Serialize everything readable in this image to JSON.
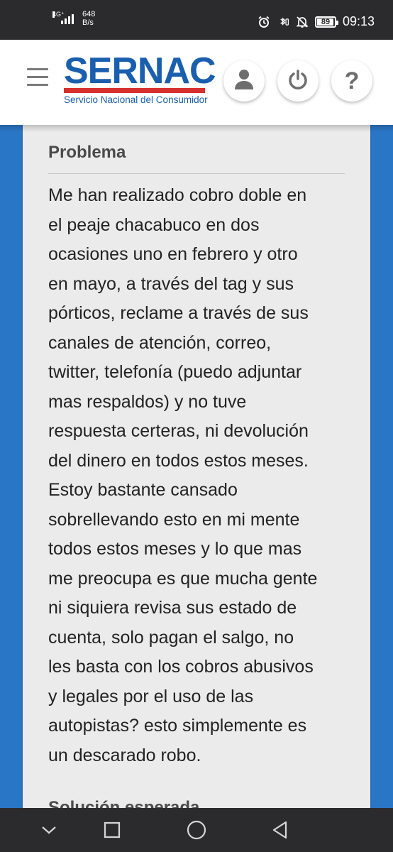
{
  "status_bar": {
    "network_type": "4G⁺",
    "speed_value": "648",
    "speed_unit": "B/s",
    "battery": "89",
    "battery_level": 0.89,
    "time": "09:13"
  },
  "header": {
    "logo_name": "SERNAC",
    "logo_subtitle": "Servicio Nacional del Consumidor",
    "buttons": [
      "user-icon",
      "power-icon",
      "help-icon"
    ],
    "help_glyph": "?"
  },
  "card": {
    "section_title": "Problema",
    "problem_text": "Me han realizado cobro doble en\nel peaje chacabuco en dos\nocasiones uno en febrero y otro\nen mayo, a través del tag y sus\npórticos, reclame a través de sus\ncanales de atención, correo,\ntwitter, telefonía (puedo adjuntar\nmas respaldos) y no tuve\nrespuesta certeras, ni devolución\ndel dinero en todos estos meses.\nEstoy bastante cansado\nsobrellevando esto en mi mente\ntodos estos meses y lo que mas\nme preocupa es que mucha gente\nni siquiera revisa sus estado de\ncuenta, solo pagan el salgo, no\nles basta con los cobros abusivos\ny legales por el uso de las\nautopistas? esto simplemente es\nun descarado robo.",
    "next_section_title": "Solución esperada"
  },
  "colors": {
    "brand_blue": "#1a5fae",
    "brand_red": "#d7312e",
    "page_background": "#2a76c6",
    "card_background": "#ebebec"
  },
  "nav_bar": {
    "buttons": [
      "chevron-down-icon",
      "recents-icon",
      "home-icon",
      "back-icon"
    ]
  }
}
